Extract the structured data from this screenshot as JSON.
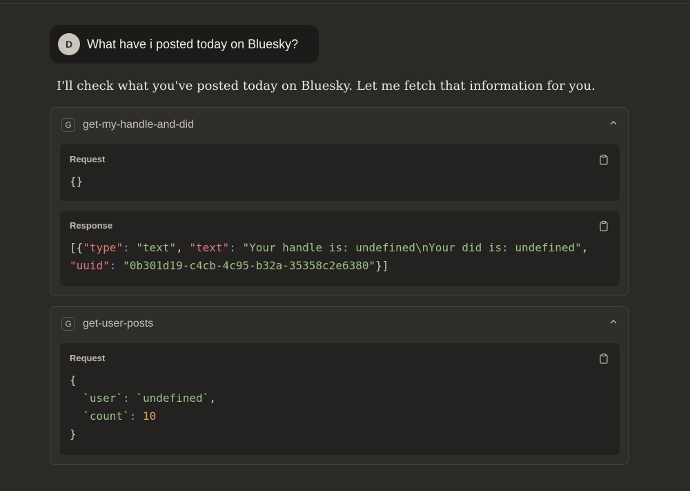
{
  "user_message": {
    "avatar_initial": "D",
    "text": "What have i posted today on Bluesky?"
  },
  "assistant_message": "I'll check what you've posted today on Bluesky. Let me fetch that information for you.",
  "tool_calls": [
    {
      "badge": "G",
      "name": "get-my-handle-and-did",
      "request_label": "Request",
      "request_body": "{}",
      "response_label": "Response",
      "response": {
        "open": "[{",
        "k1": "\"type\"",
        "v1": "\"text\"",
        "k2": "\"text\"",
        "v2": "\"Your handle is: undefined\\nYour did is: undefined\"",
        "k3": "\"uuid\"",
        "v3": "\"0b301d19-c4cb-4c95-b32a-35358c2e6380\"",
        "close": "}]"
      }
    },
    {
      "badge": "G",
      "name": "get-user-posts",
      "request_label": "Request",
      "request": {
        "open": "{",
        "k1": "`user`",
        "v1": "`undefined`",
        "k2": "`count`",
        "v2": "10",
        "close": "}"
      }
    }
  ],
  "icons": {
    "chevron": "chevron-up-icon",
    "copy": "clipboard-icon"
  },
  "colors": {
    "background": "#2b2a27",
    "key": "#e2787d",
    "string": "#9ec28a",
    "number": "#e0a165"
  }
}
